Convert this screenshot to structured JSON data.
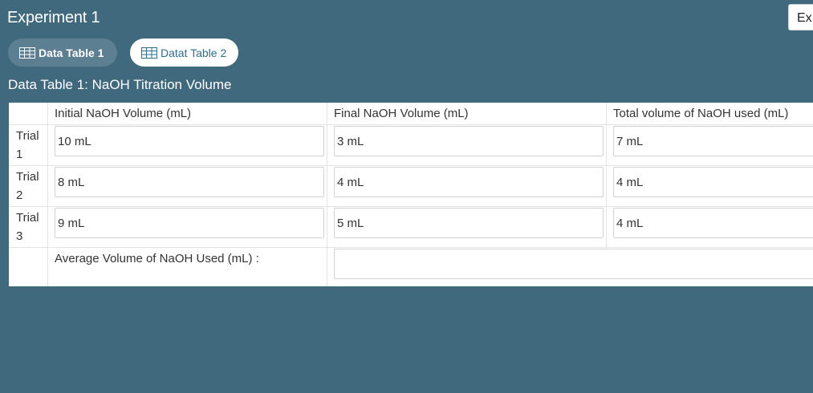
{
  "experiment": {
    "title": "Experiment 1",
    "corner_button_label": "Ex"
  },
  "tabs": [
    {
      "label": "Data Table 1",
      "icon": "table-icon",
      "active": true
    },
    {
      "label": "Datat Table 2",
      "icon": "table-icon",
      "active": false
    }
  ],
  "table": {
    "heading": "Data Table 1: NaOH Titration Volume",
    "columns": [
      "Initial NaOH Volume (mL)",
      "Final NaOH Volume (mL)",
      "Total volume of NaOH used (mL)"
    ],
    "rows": [
      {
        "label": "Trial 1",
        "initial": "10 mL",
        "final": "3 mL",
        "total": "7 mL"
      },
      {
        "label": "Trial 2",
        "initial": "8 mL",
        "final": "4 mL",
        "total": "4 mL"
      },
      {
        "label": "Trial 3",
        "initial": "9 mL",
        "final": "5 mL",
        "total": "4 mL"
      }
    ],
    "average": {
      "label": "Average Volume of NaOH Used (mL) :",
      "value": ""
    }
  },
  "colors": {
    "background": "#41697d",
    "active_tab": "#5c7f91",
    "tab_text": "#2f6d8d"
  }
}
